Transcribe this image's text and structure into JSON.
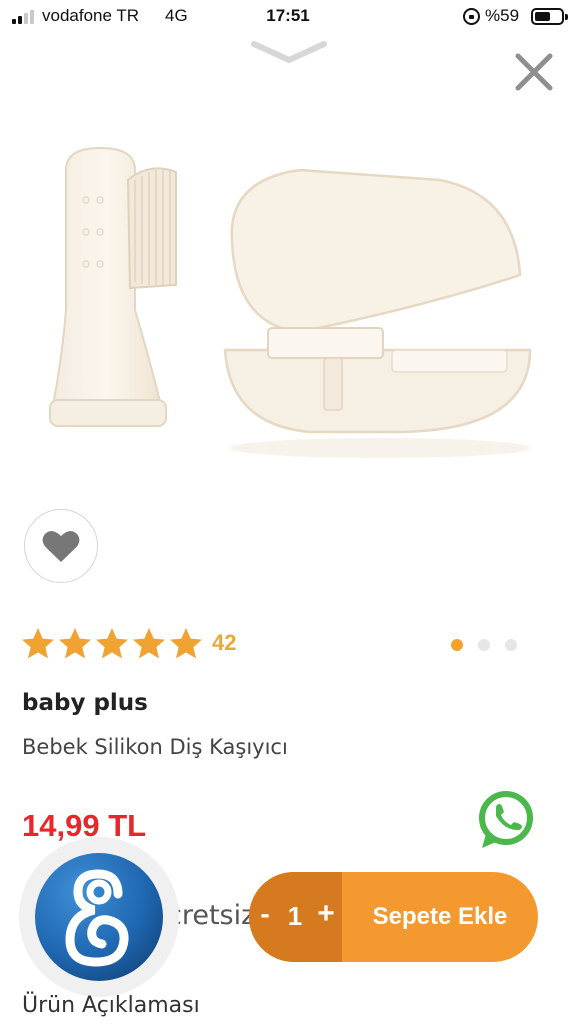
{
  "status_bar": {
    "carrier": "vodafone TR",
    "network": "4G",
    "time": "17:51",
    "battery_text": "%59",
    "battery_level": 0.59,
    "signal_bars_active": 2,
    "signal_bars_total": 4
  },
  "product": {
    "rating_value": 5,
    "rating_max": 5,
    "rating_count": "42",
    "image_index": 1,
    "image_count": 3,
    "brand": "baby plus",
    "name": "Bebek Silikon Diş Kaşıyıcı",
    "price": "14,99 TL"
  },
  "shipping": {
    "text": "Kargo Ücretsiz"
  },
  "cart": {
    "minus": "-",
    "quantity": "1",
    "plus": "+",
    "add_label": "Sepete Ekle"
  },
  "description_title": "Ürün Açıklaması",
  "icons": {
    "close": "close-icon",
    "collapse": "chevron-down-icon",
    "favorite": "heart-icon",
    "star": "star-icon",
    "whatsapp": "whatsapp-icon",
    "shipping": "truck-icon",
    "app_logo": "app-logo-icon"
  },
  "colors": {
    "accent": "#f4992f",
    "accent_dark": "#d57a1e",
    "price": "#e8262b",
    "star": "#f0a233",
    "whatsapp": "#4ab84a"
  }
}
